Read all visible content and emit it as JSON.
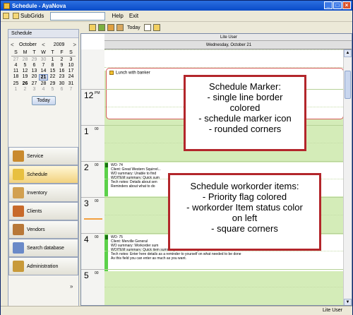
{
  "window": {
    "title": "Schedule - AyaNova"
  },
  "menu": {
    "items": [
      {
        "label": "SubGrids",
        "icon": "subgrids-icon"
      },
      {
        "label": "Help"
      },
      {
        "label": "Exit"
      }
    ]
  },
  "calendar": {
    "header": "Schedule",
    "month": "October",
    "year": "2009",
    "dow": [
      "S",
      "M",
      "T",
      "W",
      "T",
      "F",
      "S"
    ],
    "weeks": [
      [
        "27",
        "28",
        "29",
        "30",
        "1",
        "2",
        "3"
      ],
      [
        "4",
        "5",
        "6",
        "7",
        "8",
        "9",
        "10"
      ],
      [
        "11",
        "12",
        "13",
        "14",
        "15",
        "16",
        "17"
      ],
      [
        "18",
        "19",
        "20",
        "21",
        "22",
        "23",
        "24"
      ],
      [
        "25",
        "26",
        "27",
        "28",
        "29",
        "30",
        "31"
      ],
      [
        "1",
        "2",
        "3",
        "4",
        "5",
        "6",
        "7"
      ]
    ],
    "today_label": "Today"
  },
  "nav": {
    "items": [
      {
        "label": "Service",
        "icon": "service-icon",
        "color": "#c98a2e"
      },
      {
        "label": "Schedule",
        "icon": "schedule-icon",
        "color": "#e8c040"
      },
      {
        "label": "Inventory",
        "icon": "inventory-icon",
        "color": "#d2a050"
      },
      {
        "label": "Clients",
        "icon": "clients-icon",
        "color": "#c86a2a"
      },
      {
        "label": "Vendors",
        "icon": "vendors-icon",
        "color": "#b87838"
      },
      {
        "label": "Search database",
        "icon": "search-database-icon",
        "color": "#6a8ac8"
      },
      {
        "label": "Administration",
        "icon": "administration-icon",
        "color": "#c89a3a"
      }
    ],
    "expand_glyph": "»"
  },
  "toolbar": {
    "today_label": "Today"
  },
  "schedule": {
    "resource": "Lite User",
    "date": "Wednesday, October 21",
    "hours": [
      {
        "h": "12",
        "m": "PM"
      },
      {
        "h": "1",
        "m": "00"
      },
      {
        "h": "2",
        "m": "00"
      },
      {
        "h": "3",
        "m": "00"
      },
      {
        "h": "4",
        "m": "00"
      },
      {
        "h": "5",
        "m": "00"
      }
    ],
    "marker_text": "Lunch with banker",
    "wo1": [
      "WO: 74",
      "Client:  Great Western Squirrel...",
      "WO summary: Unable to find",
      "WOITEM summary: Quick sum",
      "Tech notes: Details about sen",
      "Reminders about what to do"
    ],
    "wo2": [
      "WO: 75",
      "Client:  Merville General",
      "WO summary: Workorder sum",
      "WOITEM summary: Quick item summary of what is the problem as this field is limited to 256 characters",
      "Tech notes: Enter here details as a reminder to yourself on what needed to be done",
      "As this field you can enter as much as you want."
    ]
  },
  "callouts": {
    "marker": [
      "Schedule Marker:",
      "- single line border",
      "colored",
      "- schedule marker icon",
      "- rounded corners"
    ],
    "workorder": [
      "Schedule workorder items:",
      "- Priority flag colored",
      "- workorder Item status color",
      "on left",
      "- square corners"
    ]
  },
  "status": {
    "user": "Lite User"
  }
}
